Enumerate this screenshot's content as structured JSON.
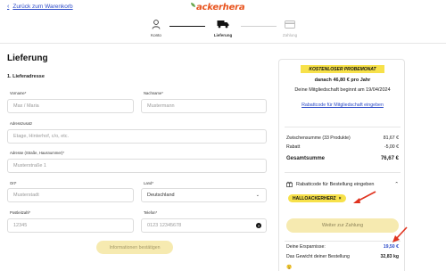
{
  "header": {
    "back_link": "Zurück zum Warenkorb",
    "logo": "ackerhera",
    "steps": [
      {
        "label": "Konto",
        "icon": "person-icon"
      },
      {
        "label": "Lieferung",
        "icon": "truck-icon"
      },
      {
        "label": "Zahlung",
        "icon": "card-icon"
      }
    ]
  },
  "form": {
    "title": "Lieferung",
    "section": "1. Lieferadresse",
    "fields": {
      "vorname": {
        "label": "Vorname*",
        "placeholder": "Max / Maria"
      },
      "nachname": {
        "label": "Nachname*",
        "placeholder": "Mustermann"
      },
      "adresszusatz": {
        "label": "Adresszusatz",
        "placeholder": "Etage, Hinterhof, c/o, etc."
      },
      "adresse": {
        "label": "Adresse (Straße, Hausnummer)*",
        "placeholder": "Musterstraße 1"
      },
      "ort": {
        "label": "Ort*",
        "placeholder": "Musterstadt"
      },
      "land": {
        "label": "Land*",
        "value": "Deutschland"
      },
      "postleitzahl": {
        "label": "Postleitzahl*",
        "placeholder": "12345"
      },
      "telefon": {
        "label": "Telefon*",
        "placeholder": "0123 12345678"
      }
    },
    "confirm_button": "Informationen bestätigen"
  },
  "summary": {
    "promo_badge": "KOSTENLOSER PROBEMONAT",
    "promo_price": "danach 46,80 € pro Jahr",
    "promo_start": "Deine Mitgliedschaft beginnt am 19/04/2024",
    "promo_link": "Rabattcode für Mitgliedschaft eingeben",
    "subtotal_label": "Zwischensumme (33 Produkte)",
    "subtotal_value": "81,67 €",
    "discount_label": "Rabatt",
    "discount_value": "-5,00 €",
    "total_label": "Gesamtsumme",
    "total_value": "76,67 €",
    "coupon_heading": "Rabattcode für Bestellung eingeben",
    "coupon_code": "HALLOACKERHERZ",
    "pay_button": "Weiter zur Zahlung",
    "savings_label": "Deine Ersparnisse:",
    "savings_value": "19,50 €",
    "weight_label": "Das Gewicht deiner Bestellung",
    "weight_value": "32,83 kg"
  },
  "colors": {
    "accent_yellow": "#f7e14a",
    "button_disabled": "#f6eab0",
    "link_blue": "#2b4ac7",
    "annotation_red": "#e0321e",
    "logo_orange": "#e8541e"
  }
}
